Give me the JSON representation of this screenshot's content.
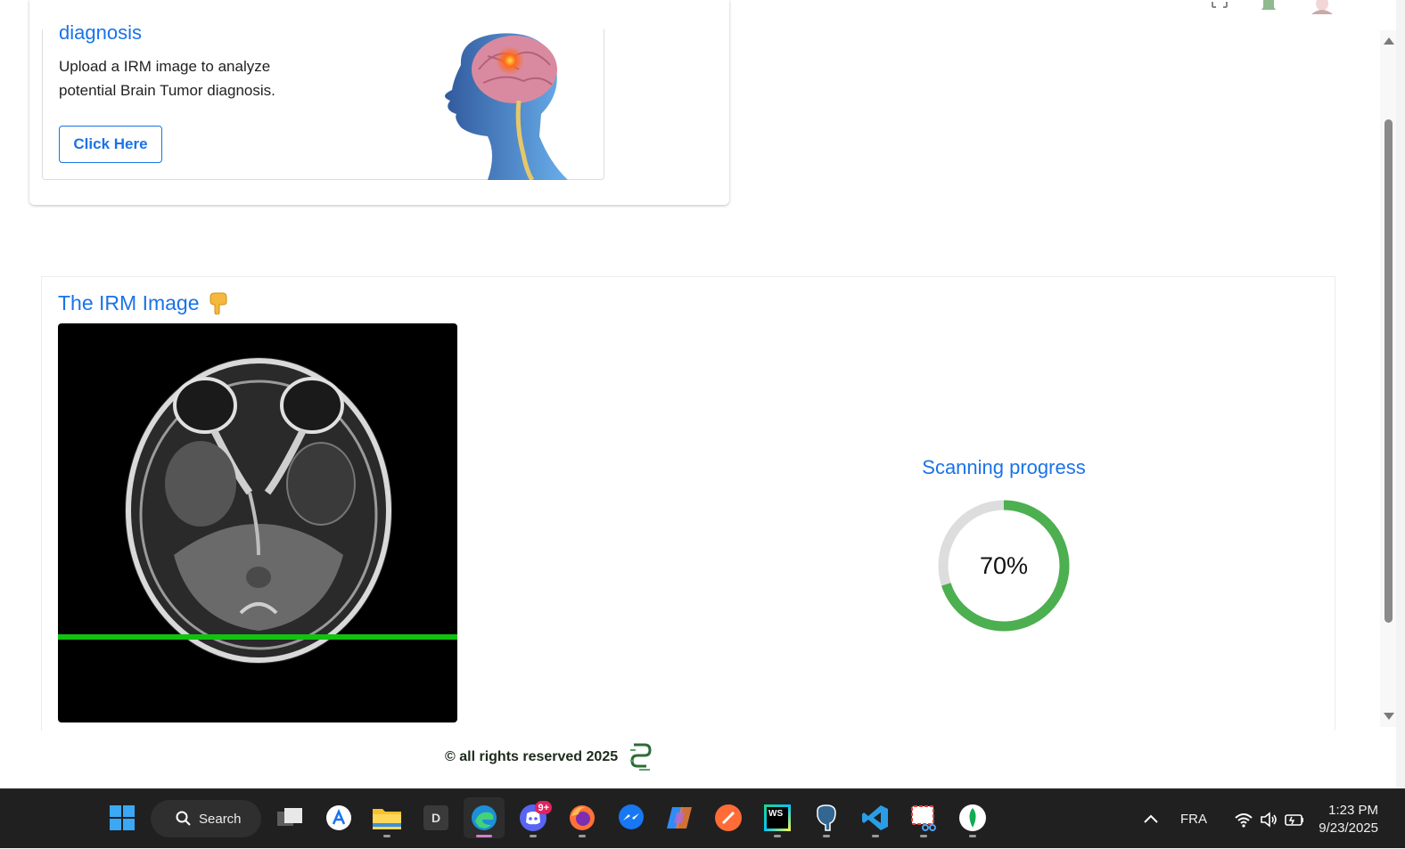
{
  "page": {
    "card": {
      "heading": "diagnosis",
      "description": "Upload a IRM image to analyze potential Brain Tumor diagnosis.",
      "button_label": "Click Here"
    },
    "scan": {
      "title": "The IRM Image",
      "progress_title": "Scanning progress",
      "progress_value": 0.7,
      "progress_label": "70%"
    },
    "footer": {
      "text": "© all rights reserved 2025"
    }
  },
  "colors": {
    "accent": "#1a73e8",
    "progress": "#4caf50",
    "progress_track": "#dddddd",
    "scan_line": "#12c212"
  },
  "taskbar": {
    "search_label": "Search",
    "apps": [
      "windows-start",
      "search",
      "task-view",
      "app-store",
      "file-explorer",
      "dev-app",
      "edge",
      "discord",
      "firefox",
      "messenger",
      "copilot",
      "postman",
      "webstorm",
      "pgadmin",
      "vscode",
      "snipping-tool",
      "mongodb-compass"
    ],
    "discord_badge": "9+",
    "dev_app_letter": "D",
    "webstorm_letters": "WS",
    "language": "FRA",
    "time": "1:23 PM",
    "date": "9/23/2025"
  }
}
